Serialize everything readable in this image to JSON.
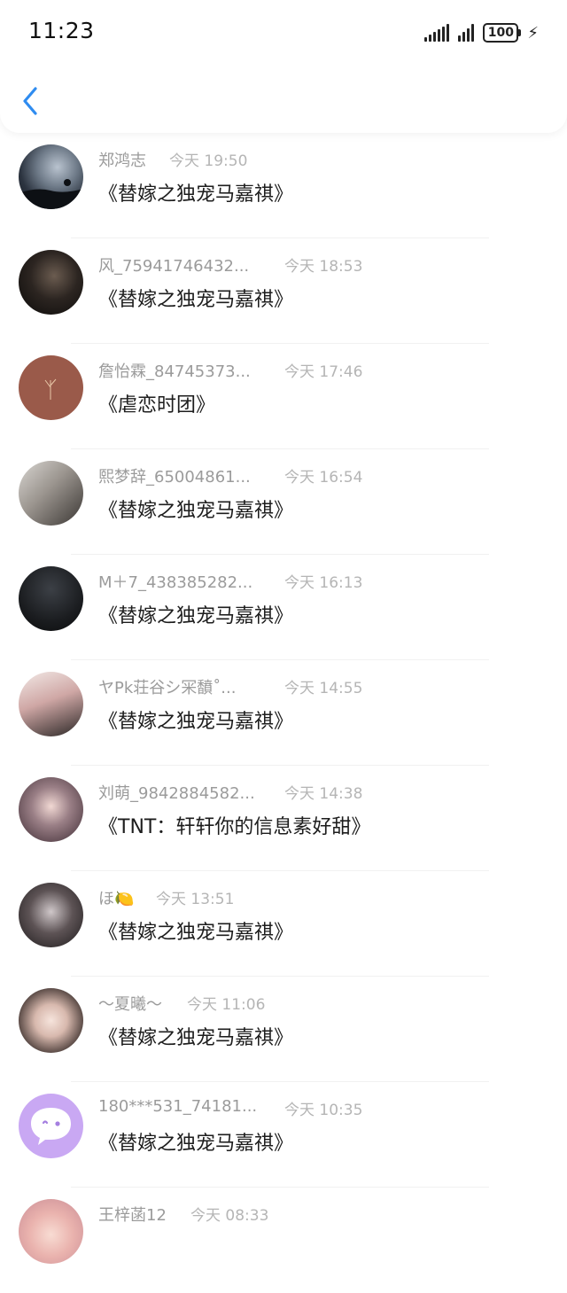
{
  "status_bar": {
    "time": "11:23",
    "battery": "100"
  },
  "feed": {
    "items": [
      {
        "name": "郑鸿志",
        "time": "今天 19:50",
        "title": "《替嫁之独宠马嘉祺》"
      },
      {
        "name": "风_75941746432...",
        "time": "今天 18:53",
        "title": "《替嫁之独宠马嘉祺》"
      },
      {
        "name": "詹怡霖_84745373...",
        "time": "今天 17:46",
        "title": "《虐恋时团》"
      },
      {
        "name": "熙梦辞_65004861...",
        "time": "今天 16:54",
        "title": "《替嫁之独宠马嘉祺》"
      },
      {
        "name": "M＋7_438385282...",
        "time": "今天 16:13",
        "title": "《替嫁之独宠马嘉祺》"
      },
      {
        "name": "ヤPk荘谷シ冞馩˚...",
        "time": "今天 14:55",
        "title": "《替嫁之独宠马嘉祺》"
      },
      {
        "name": "刘萌_9842884582...",
        "time": "今天 14:38",
        "title": "《TNT：轩轩你的信息素好甜》"
      },
      {
        "name": "ほ🍋",
        "time": "今天 13:51",
        "title": "《替嫁之独宠马嘉祺》"
      },
      {
        "name": "～夏曦～",
        "time": "今天 11:06",
        "title": "《替嫁之独宠马嘉祺》"
      },
      {
        "name": "180***531_74181...",
        "time": "今天 10:35",
        "title": "《替嫁之独宠马嘉祺》"
      },
      {
        "name": "王梓菡12",
        "time": "今天 08:33",
        "title": ""
      }
    ]
  }
}
